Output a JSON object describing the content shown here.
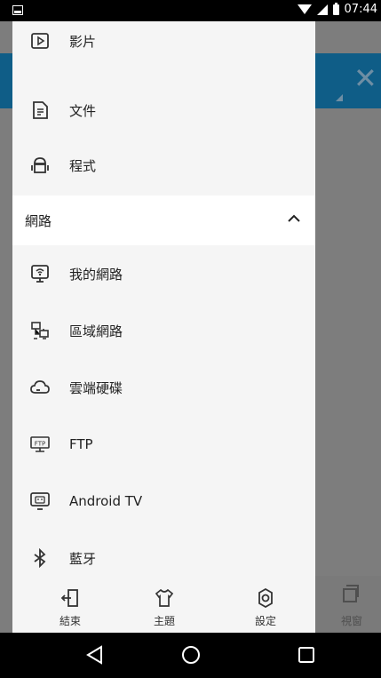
{
  "status": {
    "time": "07:44"
  },
  "drawer": {
    "media_items": [
      {
        "label": "影片",
        "icon": "video-icon"
      },
      {
        "label": "文件",
        "icon": "document-icon"
      },
      {
        "label": "程式",
        "icon": "android-app-icon"
      }
    ],
    "section": {
      "label": "網路",
      "icon": "chevron-up-icon"
    },
    "network_items": [
      {
        "label": "我的網路",
        "icon": "my-network-icon"
      },
      {
        "label": "區域網路",
        "icon": "lan-icon"
      },
      {
        "label": "雲端硬碟",
        "icon": "cloud-drive-icon"
      },
      {
        "label": "FTP",
        "icon": "ftp-icon"
      },
      {
        "label": "Android TV",
        "icon": "android-tv-icon"
      },
      {
        "label": "藍牙",
        "icon": "bluetooth-icon"
      }
    ],
    "bottom_bar": [
      {
        "label": "結束",
        "icon": "exit-icon"
      },
      {
        "label": "主題",
        "icon": "theme-shirt-icon"
      },
      {
        "label": "設定",
        "icon": "settings-icon"
      }
    ]
  },
  "background": {
    "window_label": "視窗"
  },
  "navbar": {
    "icons": [
      "back-icon",
      "home-icon",
      "recents-icon"
    ]
  }
}
